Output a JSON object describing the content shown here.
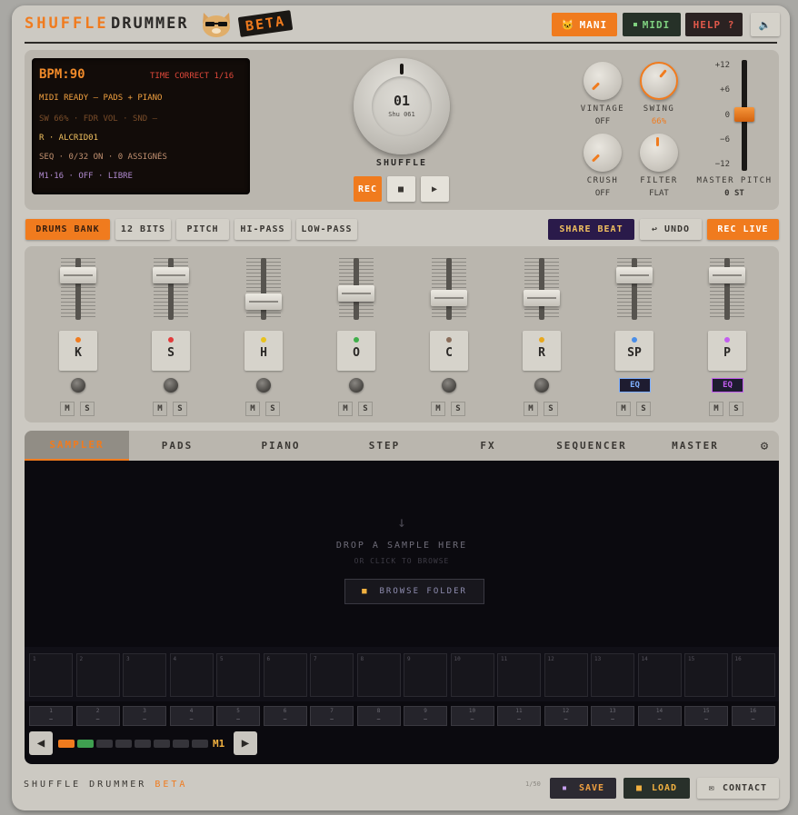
{
  "header": {
    "logo_word1": "SHUFFLE",
    "logo_word2": "DRUMMER",
    "beta": "BETA",
    "btn_mani": "MANI",
    "btn_midi": "MIDI",
    "btn_help": "HELP ?"
  },
  "lcd": {
    "bpm": "BPM:90",
    "time_correct": "TIME CORRECT 1/16",
    "midi_ready": "MIDI READY — PADS + PIANO",
    "line3": "SW 66% · FDR VOL · SND —",
    "line4": "R · ALCRID01",
    "line5": "SEQ · 0/32 ON · 0 ASSIGNÉS",
    "line6": "M1·16 · OFF · LIBRE"
  },
  "big_knob": {
    "value": "01",
    "sub": "Shu 061",
    "label": "SHUFFLE"
  },
  "transport": {
    "rec": "REC",
    "stop": "■",
    "play": "▶"
  },
  "knobs": [
    {
      "label": "VINTAGE",
      "value": "OFF"
    },
    {
      "label": "SWING",
      "value": "66%"
    },
    {
      "label": "CRUSH",
      "value": "OFF"
    },
    {
      "label": "FILTER",
      "value": "FLAT"
    }
  ],
  "pitch": {
    "ticks": [
      "+12",
      "+6",
      "0",
      "−6",
      "−12"
    ],
    "label": "MASTER PITCH",
    "value": "0 ST"
  },
  "row": {
    "drums_bank": "DRUMS BANK",
    "bits": "12 BITS",
    "pitch": "PITCH",
    "hipass": "HI-PASS",
    "lowpass": "LOW-PASS",
    "share": "SHARE BEAT",
    "undo": "↩ UNDO",
    "reclive": "REC LIVE"
  },
  "channels": [
    {
      "label": "K",
      "dot": "#f07b1e",
      "level": 0.82,
      "eq": false
    },
    {
      "label": "S",
      "dot": "#e23b3b",
      "level": 0.82,
      "eq": false
    },
    {
      "label": "H",
      "dot": "#e8c21e",
      "level": 0.28,
      "eq": false
    },
    {
      "label": "O",
      "dot": "#3fae4a",
      "level": 0.45,
      "eq": false
    },
    {
      "label": "C",
      "dot": "#8a6d5a",
      "level": 0.35,
      "eq": false
    },
    {
      "label": "R",
      "dot": "#e8a81e",
      "level": 0.35,
      "eq": false
    },
    {
      "label": "SP",
      "dot": "#4a8ee8",
      "level": 0.82,
      "eq": true,
      "eq_color": "#7fb0ff"
    },
    {
      "label": "P",
      "dot": "#c35ef0",
      "level": 0.82,
      "eq": true,
      "eq_color": "#c35ef0"
    }
  ],
  "ms": {
    "m": "M",
    "s": "S"
  },
  "tabs": [
    "SAMPLER",
    "PADS",
    "PIANO",
    "STEP",
    "FX",
    "SEQUENCER",
    "MASTER"
  ],
  "sampler": {
    "arrow": "↓",
    "drop": "DROP A SAMPLE HERE",
    "click": "OR CLICK TO BROWSE",
    "browse": "BROWSE FOLDER"
  },
  "cells": [
    "1",
    "2",
    "3",
    "4",
    "5",
    "6",
    "7",
    "8",
    "9",
    "10",
    "11",
    "12",
    "13",
    "14",
    "15",
    "16"
  ],
  "steps": [
    "1",
    "2",
    "3",
    "4",
    "5",
    "6",
    "7",
    "8",
    "9",
    "10",
    "11",
    "12",
    "13",
    "14",
    "15",
    "16"
  ],
  "pager": {
    "label": "M1",
    "active": 0,
    "green": 1,
    "count": 8
  },
  "footer": {
    "word1": "SHUFFLE DRUMMER",
    "beta": "BETA",
    "count": "1/50",
    "save": "SAVE",
    "load": "LOAD",
    "contact": "CONTACT"
  }
}
